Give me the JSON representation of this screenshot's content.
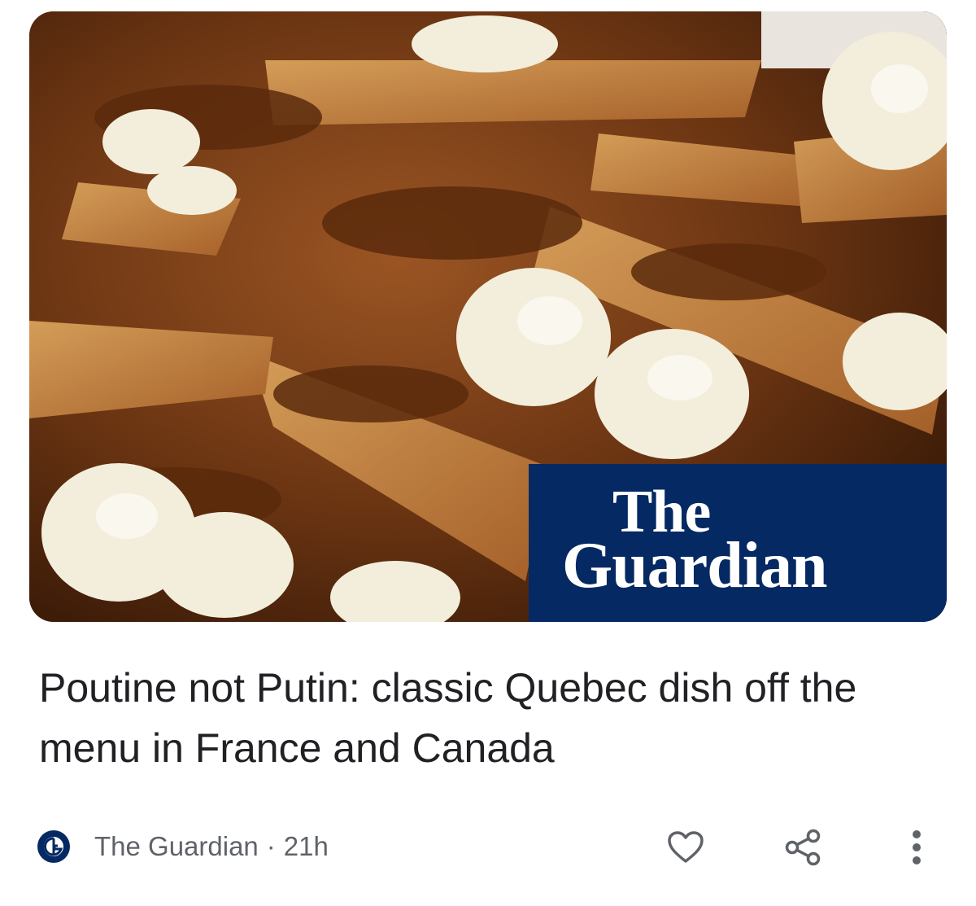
{
  "image": {
    "subject": "poutine",
    "brand_overlay": {
      "line1": "The",
      "line2": "Guardian",
      "background": "#052962"
    }
  },
  "headline": "Poutine not Putin: classic Quebec dish off the menu in France and Canada",
  "source": {
    "logo_icon": "guardian-logo-icon",
    "name": "The Guardian",
    "separator": "·",
    "age": "21h"
  },
  "actions": [
    {
      "icon": "heart-icon",
      "name": "like"
    },
    {
      "icon": "share-icon",
      "name": "share"
    },
    {
      "icon": "more-vert-icon",
      "name": "more"
    }
  ],
  "colors": {
    "headline": "#202124",
    "meta": "#5f6368",
    "icon": "#5f6368",
    "brand": "#052962"
  }
}
